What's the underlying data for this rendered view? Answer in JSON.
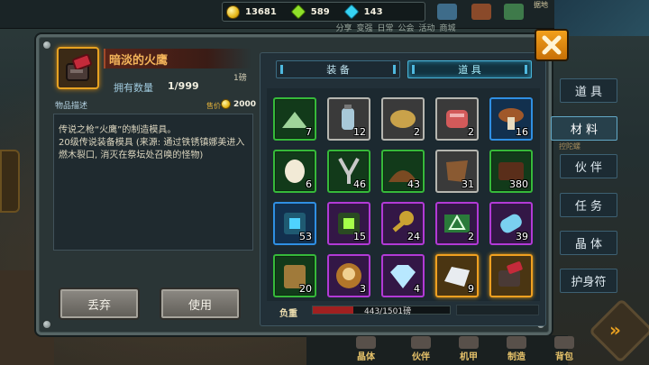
{
  "resources": [
    {
      "icon": "gold-coin-icon",
      "value": "13681"
    },
    {
      "icon": "green-gem-icon",
      "value": "589"
    },
    {
      "icon": "blue-diamond-icon",
      "value": "143"
    }
  ],
  "top_menu": [
    "分享",
    "变强",
    "日常",
    "公会",
    "活动",
    "商城"
  ],
  "top_tag": "据地",
  "item": {
    "name": "暗淡的火鹰",
    "weight": "1磅",
    "own_label": "拥有数量",
    "own_value": "1/999",
    "desc_tab": "物品描述",
    "price_label": "售价",
    "price_value": "2000",
    "description": "传说之枪“火鹰”的制造模具。\n20级传说装备模具 (来源: 通过铁锈镇娜美进入燃木裂口, 消灭在祭坛处召唤的怪物)",
    "discard": "丢弃",
    "use": "使用"
  },
  "tabs": {
    "equip": "装 备",
    "items": "道 具"
  },
  "inventory": [
    {
      "icon": "powder-pile-icon",
      "rarity": "green",
      "count": "7"
    },
    {
      "icon": "gas-canister-icon",
      "rarity": "white",
      "count": "12"
    },
    {
      "icon": "potato-icon",
      "rarity": "white",
      "count": "2"
    },
    {
      "icon": "raw-meat-icon",
      "rarity": "white",
      "count": "2"
    },
    {
      "icon": "mushroom-icon",
      "rarity": "blue",
      "count": "16"
    },
    {
      "icon": "egg-icon",
      "rarity": "green",
      "count": "6"
    },
    {
      "icon": "metal-fork-icon",
      "rarity": "green",
      "count": "46"
    },
    {
      "icon": "dirt-pile-icon",
      "rarity": "green",
      "count": "43"
    },
    {
      "icon": "leather-hide-icon",
      "rarity": "white",
      "count": "31"
    },
    {
      "icon": "chocolate-block-icon",
      "rarity": "green",
      "count": "380"
    },
    {
      "icon": "blue-crystal-ore-icon",
      "rarity": "blue",
      "count": "53"
    },
    {
      "icon": "green-crystal-ore-icon",
      "rarity": "purple",
      "count": "15"
    },
    {
      "icon": "gear-key-icon",
      "rarity": "purple",
      "count": "24"
    },
    {
      "icon": "circuit-board-icon",
      "rarity": "purple",
      "count": "2"
    },
    {
      "icon": "energy-capsule-icon",
      "rarity": "purple",
      "count": "39"
    },
    {
      "icon": "fuel-jerrycan-icon",
      "rarity": "green",
      "count": "20"
    },
    {
      "icon": "skull-medal-icon",
      "rarity": "purple",
      "count": "3"
    },
    {
      "icon": "diamond-gem-icon",
      "rarity": "purple",
      "count": "4"
    },
    {
      "icon": "silver-ingot-icon",
      "rarity": "orange",
      "count": "9"
    },
    {
      "icon": "firehawk-blueprint-icon",
      "rarity": "orange",
      "count": ""
    }
  ],
  "load": {
    "label": "负重",
    "text": "443/1501磅",
    "fraction": 0.295
  },
  "side_nav": [
    {
      "label": "道 具",
      "active": false
    },
    {
      "label": "材 料",
      "active": true
    },
    {
      "label": "伙 伴",
      "active": false
    },
    {
      "label": "任 务",
      "active": false
    },
    {
      "label": "晶 体",
      "active": false
    },
    {
      "label": "护身符",
      "active": false
    }
  ],
  "side_hints": [
    "控陀螺"
  ],
  "bottom_nav": [
    "晶体",
    "伙伴",
    "机甲",
    "制造",
    "背包"
  ],
  "colors": {
    "green": "#36b93a",
    "white": "#b6b6b0",
    "blue": "#2f8fe3",
    "purple": "#b23ad6",
    "orange": "#f0a020",
    "accent": "#f2a01c"
  }
}
